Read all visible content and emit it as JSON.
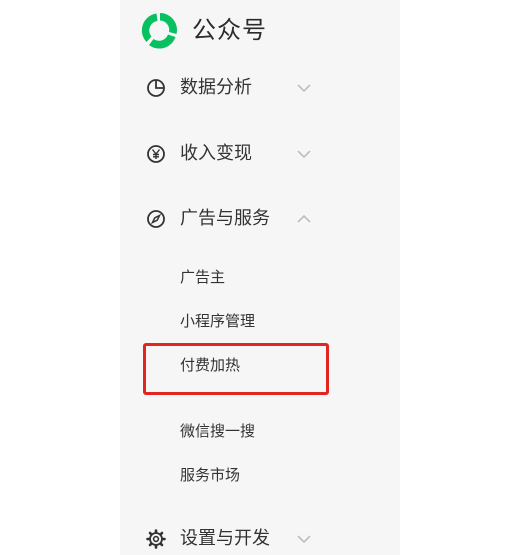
{
  "header": {
    "logo_icon": "wechat-official-account-logo",
    "title": "公众号",
    "brand_color": "#07c160"
  },
  "menu": [
    {
      "id": "data-analysis",
      "label": "数据分析",
      "icon": "pie-chart-icon",
      "expanded": false
    },
    {
      "id": "income",
      "label": "收入变现",
      "icon": "yen-icon",
      "expanded": false
    },
    {
      "id": "ads-services",
      "label": "广告与服务",
      "icon": "compass-icon",
      "expanded": true,
      "children": [
        {
          "label": "广告主"
        },
        {
          "label": "小程序管理"
        },
        {
          "label": "付费加热",
          "highlighted": true
        },
        {
          "label": "微信搜一搜"
        },
        {
          "label": "服务市场"
        }
      ]
    },
    {
      "id": "settings-dev",
      "label": "设置与开发",
      "icon": "gear-icon",
      "expanded": false
    }
  ],
  "colors": {
    "sidebar_bg": "#f6f6f7",
    "text": "#333333",
    "highlight_border": "#e3241f"
  }
}
